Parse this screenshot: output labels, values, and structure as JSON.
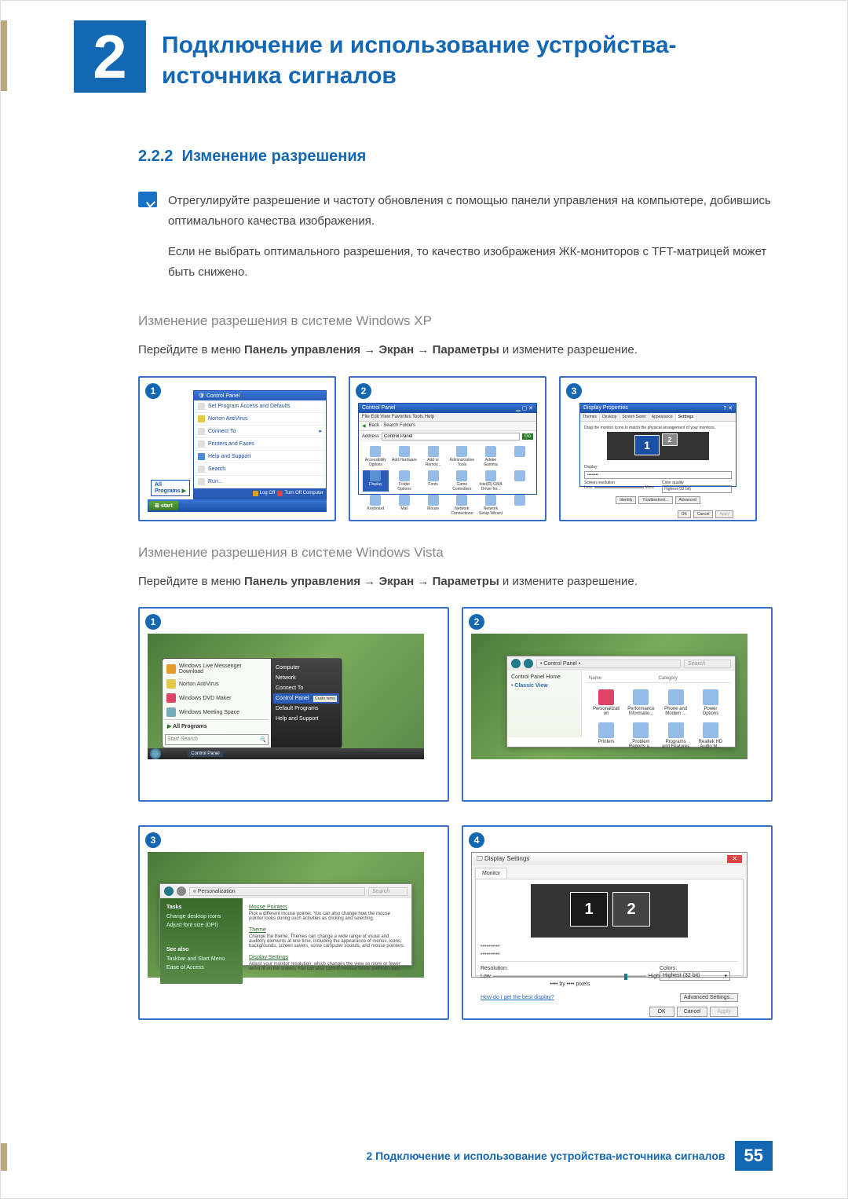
{
  "chapter": {
    "number": "2",
    "title": "Подключение и использование устройства-источника сигналов"
  },
  "section": {
    "number": "2.2.2",
    "title": "Изменение разрешения"
  },
  "note": {
    "p1": "Отрегулируйте разрешение и частоту обновления с помощью панели управления на компьютере, добившись оптимального качества изображения.",
    "p2": "Если не выбрать оптимального разрешения, то качество изображения ЖК-мониторов с TFT-матрицей может быть снижено."
  },
  "xp": {
    "heading": "Изменение разрешения в системе Windows XP",
    "instruction_pre": "Перейдите в меню ",
    "path1": "Панель управления",
    "path2": "Экран",
    "path3": "Параметры",
    "instruction_post": " и измените разрешение.",
    "shots": {
      "s1": {
        "num": "1",
        "menu_title": "Control Panel",
        "items": [
          "Set Program Access and Defaults",
          "Norton AntiVirus",
          "Connect To",
          "Printers and Faxes",
          "Help and Support",
          "Search",
          "Run..."
        ],
        "all_programs": "All Programs",
        "log_off": "Log Off",
        "turn_off": "Turn Off Computer",
        "start": "start"
      },
      "s2": {
        "num": "2",
        "title": "Control Panel",
        "menubar": "File  Edit  View  Favorites  Tools  Help",
        "toolbar_items": "Back  ·  Search  Folders",
        "address_label": "Address",
        "address_value": "Control Panel",
        "go": "Go",
        "icons": [
          "Accessibility Options",
          "Add Hardware",
          "Add or Remov...",
          "Administrative Tools",
          "Adobe Gamma",
          "",
          "Display",
          "Folder Options",
          "Fonts",
          "Game Controllers",
          "Intel(R) GMA Driver for...",
          "",
          "Keyboard",
          "Mail",
          "Mouse",
          "Network Connections",
          "Network Setup Wizard",
          ""
        ]
      },
      "s3": {
        "num": "3",
        "title": "Display Properties",
        "tabs": [
          "Themes",
          "Desktop",
          "Screen Saver",
          "Appearance",
          "Settings"
        ],
        "drag_text": "Drag the monitor icons to match the physical arrangement of your monitors.",
        "mon1": "1",
        "mon2": "2",
        "display_label": "Display:",
        "dots": "••••••••",
        "res_label": "Screen resolution",
        "less": "Less",
        "more": "More",
        "cq_label": "Color quality",
        "cq_value": "Highest (32 bit)",
        "btns": [
          "Identify",
          "Troubleshoot...",
          "Advanced"
        ],
        "ok": "OK",
        "cancel": "Cancel",
        "apply": "Apply"
      }
    }
  },
  "vista": {
    "heading": "Изменение разрешения в системе Windows Vista",
    "instruction_pre": "Перейдите в меню ",
    "path1": "Панель управления",
    "path2": "Экран",
    "path3": "Параметры",
    "instruction_post": " и измените разрешение.",
    "shots": {
      "s1": {
        "num": "1",
        "items": [
          "Windows Live Messenger Download",
          "Norton AntiVirus",
          "Windows DVD Maker",
          "Windows Meeting Space"
        ],
        "all_programs": "All Programs",
        "search": "Start Search",
        "right_items": [
          "Computer",
          "Network",
          "Connect To",
          "Control Panel",
          "Default Programs",
          "Help and Support"
        ],
        "custo": "Custo remo",
        "taskbar": "Control Panel"
      },
      "s2": {
        "num": "2",
        "breadcrumb": "• Control Panel •",
        "search": "Search",
        "side1": "Control Panel Home",
        "side2": "Classic View",
        "col_name": "Name",
        "col_cat": "Category",
        "icons": [
          "Personalizati on",
          "Performance Informatio...",
          "Phone and Modem ...",
          "Power Options",
          "Printers",
          "Problem Reports a...",
          "Programs and Features",
          "Realtek HD Audio M..."
        ]
      },
      "s3": {
        "num": "3",
        "breadcrumb": "« Personalization",
        "search": "Search",
        "tasks": "Tasks",
        "task1": "Change desktop icons",
        "task2": "Adjust font size (DPI)",
        "see_also": "See also",
        "sa1": "Taskbar and Start Menu",
        "sa2": "Ease of Access",
        "sec1_h": "Mouse Pointers",
        "sec1_t": "Pick a different mouse pointer. You can also change how the mouse pointer looks during such activities as clicking and selecting.",
        "sec2_h": "Theme",
        "sec2_t": "Change the theme. Themes can change a wide range of visual and auditory elements at one time, including the appearance of menus, icons, backgrounds, screen savers, some computer sounds, and mouse pointers.",
        "sec3_h": "Display Settings",
        "sec3_t": "Adjust your monitor resolution, which changes the view so more or fewer items fit on the screen. You can also control monitor flicker (refresh rate)."
      },
      "s4": {
        "num": "4",
        "title": "Display Settings",
        "tab": "Monitor",
        "mon1": "1",
        "mon2": "2",
        "dots1": "••••••••••",
        "dots2": "••••••••••",
        "res": "Resolution:",
        "low": "Low",
        "high": "High",
        "pixels": "•••• by •••• pixels",
        "colors": "Colors:",
        "colors_value": "Highest (32 bit)",
        "link": "How do I get the best display?",
        "adv": "Advanced Settings...",
        "ok": "OK",
        "cancel": "Cancel",
        "apply": "Apply"
      }
    }
  },
  "footer": {
    "text": "2 Подключение и использование устройства-источника сигналов",
    "page": "55"
  }
}
